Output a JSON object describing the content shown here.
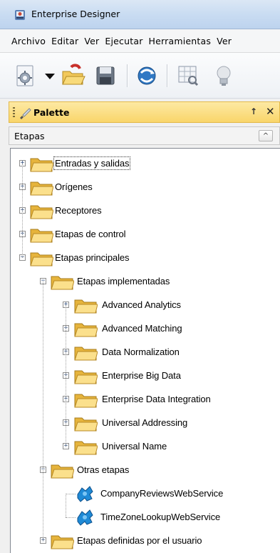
{
  "window": {
    "title": "Enterprise Designer"
  },
  "menu": [
    "Archivo",
    "Editar",
    "Ver",
    "Ejecutar",
    "Herramientas",
    "Ver"
  ],
  "toolbar": {
    "icons": [
      "settings-gear-icon",
      "dropdown-arrow-icon",
      "open-folder-icon",
      "save-disk-icon",
      "refresh-globe-icon",
      "chart-inspect-icon",
      "lightbulb-icon"
    ]
  },
  "palette": {
    "title": "Palette",
    "pin_glyph": "↑",
    "close_glyph": "✕",
    "section_label": "Etapas",
    "chevron_glyph": "^"
  },
  "tree": [
    {
      "label": "Entradas y salidas",
      "level": 0,
      "type": "folder",
      "expander": "+",
      "focused": true
    },
    {
      "label": "Orígenes",
      "level": 0,
      "type": "folder",
      "expander": "+"
    },
    {
      "label": "Receptores",
      "level": 0,
      "type": "folder",
      "expander": "+"
    },
    {
      "label": "Etapas de control",
      "level": 0,
      "type": "folder",
      "expander": "+"
    },
    {
      "label": "Etapas principales",
      "level": 0,
      "type": "folder",
      "expander": "−"
    },
    {
      "label": "Etapas implementadas",
      "level": 1,
      "type": "folder",
      "expander": "−"
    },
    {
      "label": "Advanced Analytics",
      "level": 2,
      "type": "folder",
      "expander": "+"
    },
    {
      "label": "Advanced Matching",
      "level": 2,
      "type": "folder",
      "expander": "+"
    },
    {
      "label": "Data Normalization",
      "level": 2,
      "type": "folder",
      "expander": "+"
    },
    {
      "label": "Enterprise Big Data",
      "level": 2,
      "type": "folder",
      "expander": "+"
    },
    {
      "label": "Enterprise Data Integration",
      "level": 2,
      "type": "folder",
      "expander": "+"
    },
    {
      "label": "Universal Addressing",
      "level": 2,
      "type": "folder",
      "expander": "+"
    },
    {
      "label": "Universal Name",
      "level": 2,
      "type": "folder",
      "expander": "+"
    },
    {
      "label": "Otras etapas",
      "level": 1,
      "type": "folder",
      "expander": "−"
    },
    {
      "label": "CompanyReviewsWebService",
      "level": 2,
      "type": "webservice"
    },
    {
      "label": "TimeZoneLookupWebService",
      "level": 2,
      "type": "webservice"
    },
    {
      "label": "Etapas definidas por el usuario",
      "level": 1,
      "type": "folder",
      "expander": "+"
    }
  ]
}
